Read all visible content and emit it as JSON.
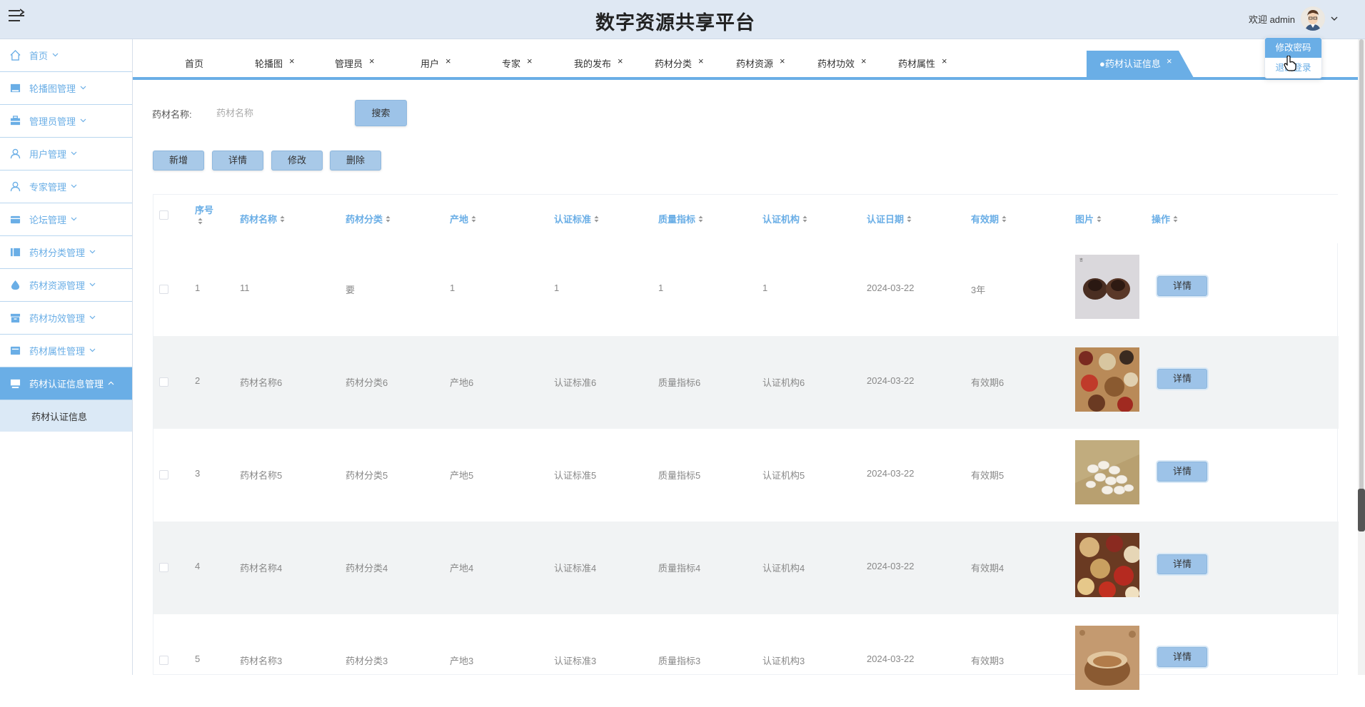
{
  "header": {
    "title": "数字资源共享平台",
    "welcome": "欢迎 admin",
    "dropdown": {
      "change_password": "修改密码",
      "logout": "退出登录"
    }
  },
  "sidebar": {
    "items": [
      {
        "label": "首页",
        "icon": "home-icon"
      },
      {
        "label": "轮播图管理",
        "icon": "image-icon"
      },
      {
        "label": "管理员管理",
        "icon": "briefcase-icon"
      },
      {
        "label": "用户管理",
        "icon": "user-icon"
      },
      {
        "label": "专家管理",
        "icon": "user-icon"
      },
      {
        "label": "论坛管理",
        "icon": "wallet-icon"
      },
      {
        "label": "药材分类管理",
        "icon": "book-icon"
      },
      {
        "label": "药材资源管理",
        "icon": "drop-icon"
      },
      {
        "label": "药材功效管理",
        "icon": "box-icon"
      },
      {
        "label": "药材属性管理",
        "icon": "card-icon"
      },
      {
        "label": "药材认证信息管理",
        "icon": "monitor-icon"
      }
    ],
    "sub_item": "药材认证信息"
  },
  "tabs": [
    {
      "label": "首页"
    },
    {
      "label": "轮播图"
    },
    {
      "label": "管理员"
    },
    {
      "label": "用户"
    },
    {
      "label": "专家"
    },
    {
      "label": "我的发布"
    },
    {
      "label": "药材分类"
    },
    {
      "label": "药材资源"
    },
    {
      "label": "药材功效"
    },
    {
      "label": "药材属性"
    }
  ],
  "active_tab": "●药材认证信息",
  "close_glyph": "×",
  "search": {
    "label": "药材名称:",
    "placeholder": "药材名称",
    "value": "",
    "button": "搜索"
  },
  "actions": {
    "add": "新增",
    "detail": "详情",
    "edit": "修改",
    "delete": "删除"
  },
  "table": {
    "headers": [
      "序号",
      "药材名称",
      "药材分类",
      "产地",
      "认证标准",
      "质量指标",
      "认证机构",
      "认证日期",
      "有效期",
      "图片",
      "操作"
    ],
    "row_action": "详情",
    "rows": [
      {
        "no": "1",
        "name": "11",
        "category": "要",
        "origin": "1",
        "standard": "1",
        "quality": "1",
        "agency": "1",
        "date": "2024-03-22",
        "validity": "3年",
        "image": "herb-cups"
      },
      {
        "no": "2",
        "name": "药材名称6",
        "category": "药材分类6",
        "origin": "产地6",
        "standard": "认证标准6",
        "quality": "质量指标6",
        "agency": "认证机构6",
        "date": "2024-03-22",
        "validity": "有效期6",
        "image": "herb-mix"
      },
      {
        "no": "3",
        "name": "药材名称5",
        "category": "药材分类5",
        "origin": "产地5",
        "standard": "认证标准5",
        "quality": "质量指标5",
        "agency": "认证机构5",
        "date": "2024-03-22",
        "validity": "有效期5",
        "image": "herb-beans"
      },
      {
        "no": "4",
        "name": "药材名称4",
        "category": "药材分类4",
        "origin": "产地4",
        "standard": "认证标准4",
        "quality": "质量指标4",
        "agency": "认证机构4",
        "date": "2024-03-22",
        "validity": "有效期4",
        "image": "herb-slices"
      },
      {
        "no": "5",
        "name": "药材名称3",
        "category": "药材分类3",
        "origin": "产地3",
        "standard": "认证标准3",
        "quality": "质量指标3",
        "agency": "认证机构3",
        "date": "2024-03-22",
        "validity": "有效期3",
        "image": "herb-bowl"
      }
    ]
  },
  "colors": {
    "accent": "#6aaee6",
    "header_bg": "#dfe8f3",
    "button": "#9dc3e8"
  }
}
